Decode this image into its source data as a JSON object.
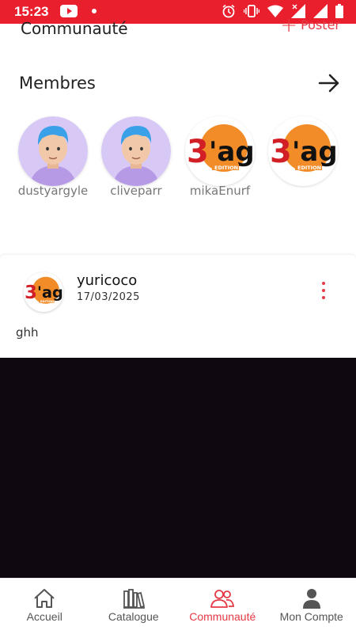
{
  "status_bar": {
    "time": "15:23",
    "icons": [
      "youtube-icon",
      "dot-icon",
      "alarm-icon",
      "vibrate-icon",
      "wifi-icon",
      "signal-icon",
      "signal-icon",
      "battery-icon"
    ]
  },
  "header": {
    "title": "Communauté",
    "post_label": "Poster"
  },
  "members": {
    "title": "Membres",
    "items": [
      {
        "name": "dustyargyle",
        "avatar": "person-avatar"
      },
      {
        "name": "cliveparr",
        "avatar": "person-avatar"
      },
      {
        "name": "mikaEnurf",
        "avatar": "3ag-edition-logo"
      },
      {
        "name": "",
        "avatar": "3ag-edition-logo"
      }
    ]
  },
  "post": {
    "author": "yuricoco",
    "date": "17/03/2025",
    "text": "ghh",
    "menu_icon": "more-vertical-icon"
  },
  "nav": {
    "items": [
      {
        "label": "Accueil",
        "icon": "home-icon",
        "active": false
      },
      {
        "label": "Catalogue",
        "icon": "books-icon",
        "active": false
      },
      {
        "label": "Communauté",
        "icon": "community-icon",
        "active": true
      },
      {
        "label": "Mon Compte",
        "icon": "account-icon",
        "active": false
      }
    ]
  },
  "colors": {
    "accent": "#e63946",
    "status_bar": "#ea1f2e",
    "media_bg": "#0f0810"
  }
}
